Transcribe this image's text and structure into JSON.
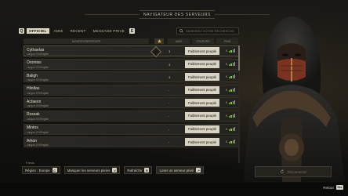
{
  "window": {
    "title": "NAVIGATEUR DES SERVEURS"
  },
  "tabs": {
    "left_key": "Q",
    "right_key": "E",
    "items": [
      {
        "label": "OFFICIEL",
        "active": true
      },
      {
        "label": "AMIS",
        "active": false
      },
      {
        "label": "RECENT",
        "active": false
      },
      {
        "label": "MESSAGE PRIVE",
        "active": false
      }
    ]
  },
  "search": {
    "placeholder": "SAISISSEZ VOTRE RECHERCHE",
    "icon": "search-icon"
  },
  "table": {
    "headers": {
      "world": "MONDES/SERVEURS",
      "fav": "",
      "players": "AMIS",
      "population": "JOUEURS",
      "ping": "PING"
    },
    "rows": [
      {
        "name": "Cythaelas",
        "lang": "Langue: EN/English",
        "players": "1",
        "population": "Faiblement peuplé",
        "ping": "0",
        "favorite": true
      },
      {
        "name": "Oromiss",
        "lang": "Langue: EN/English",
        "players": "1",
        "population": "Faiblement peuplé",
        "ping": "0"
      },
      {
        "name": "Baligh",
        "lang": "Langue: EN/English",
        "players": "1",
        "population": "Faiblement peuplé",
        "ping": "0"
      },
      {
        "name": "Hiloltas",
        "lang": "Langue: EN/English",
        "players": "-",
        "population": "Faiblement peuplé",
        "ping": "0"
      },
      {
        "name": "Actaeon",
        "lang": "Langue: EN/English",
        "players": "-",
        "population": "Faiblement peuplé",
        "ping": "0"
      },
      {
        "name": "Rossak",
        "lang": "Langue: EN/English",
        "players": "-",
        "population": "Faiblement peuplé",
        "ping": "0"
      },
      {
        "name": "Mintos",
        "lang": "Langue: EN/English",
        "players": "-",
        "population": "Faiblement peuplé",
        "ping": "0"
      },
      {
        "name": "Arkon",
        "lang": "Langue: EN/English",
        "players": "-",
        "population": "Faiblement peuplé",
        "ping": "0"
      }
    ],
    "partial_row_label": "Farsis"
  },
  "bottom": {
    "region_label": "Région : Europe",
    "region_key": "C",
    "hide_full_label": "Masquer les serveurs pleins",
    "hide_full_key": "V",
    "refresh_label": "Rafraîchir",
    "refresh_key": "R",
    "join_label": "Loser un serveur privé",
    "join_key": "↗"
  },
  "reconnect": {
    "label": "Reconnecter",
    "icon": "reconnect-icon"
  },
  "footer": {
    "back_label": "Retour",
    "back_key": "Esc"
  },
  "colors": {
    "accent": "#d8d3c2",
    "ping_green": "#7fd14b",
    "background": "#0b0b0a"
  }
}
